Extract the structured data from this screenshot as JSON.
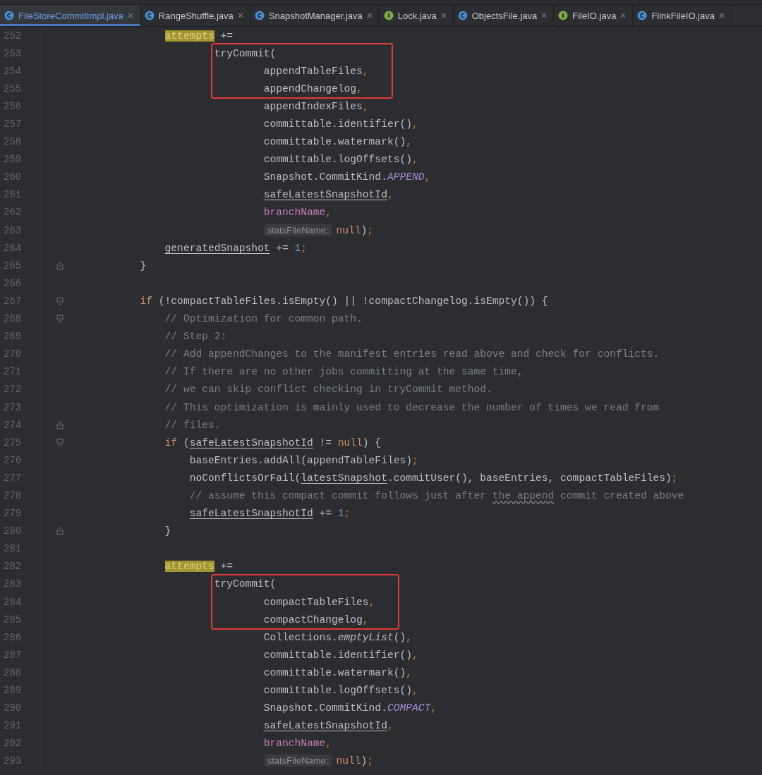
{
  "tabs": [
    {
      "label": "FileStoreCommitImpl.java",
      "kind": "class",
      "selected": true
    },
    {
      "label": "RangeShuffle.java",
      "kind": "class",
      "selected": false
    },
    {
      "label": "SnapshotManager.java",
      "kind": "class",
      "selected": false
    },
    {
      "label": "Lock.java",
      "kind": "interface",
      "selected": false
    },
    {
      "label": "ObjectsFile.java",
      "kind": "abstract",
      "selected": false
    },
    {
      "label": "FileIO.java",
      "kind": "interface",
      "selected": false
    },
    {
      "label": "FlinkFileIO.java",
      "kind": "class",
      "selected": false
    }
  ],
  "code": {
    "lines": [
      {
        "children": [
          {
            "number": "252",
            "continues": true,
            "tokens": [
              {
                "kind": "match",
                "text": "attempts"
              },
              {
                "text": " +="
              }
            ],
            "children": [
              {
                "number": "253",
                "boxed": true,
                "continues": true,
                "tokens": [
                  {
                    "text": "tryCommit("
                  }
                ],
                "children": [
                  {
                    "number": "254",
                    "boxed": true,
                    "tokens": [
                      {
                        "text": "appendTableFiles"
                      },
                      {
                        "kind": "punct",
                        "text": ","
                      }
                    ]
                  },
                  {
                    "number": "255",
                    "boxed": true,
                    "tokens": [
                      {
                        "text": "appendChangelog"
                      },
                      {
                        "kind": "punct",
                        "text": ","
                      }
                    ]
                  },
                  {
                    "number": "256",
                    "tokens": [
                      {
                        "text": "appendIndexFiles"
                      },
                      {
                        "kind": "punct",
                        "text": ","
                      }
                    ]
                  },
                  {
                    "number": "257",
                    "tokens": [
                      {
                        "text": "committable.identifier()"
                      },
                      {
                        "kind": "punct",
                        "text": ","
                      }
                    ]
                  },
                  {
                    "number": "258",
                    "tokens": [
                      {
                        "text": "committable.watermark()"
                      },
                      {
                        "kind": "punct",
                        "text": ","
                      }
                    ]
                  },
                  {
                    "number": "259",
                    "tokens": [
                      {
                        "text": "committable.logOffsets()"
                      },
                      {
                        "kind": "punct",
                        "text": ","
                      }
                    ]
                  },
                  {
                    "number": "260",
                    "tokens": [
                      {
                        "text": "Snapshot.CommitKind."
                      },
                      {
                        "kind": "const",
                        "text": "APPEND"
                      },
                      {
                        "kind": "punct",
                        "text": ","
                      }
                    ]
                  },
                  {
                    "number": "261",
                    "tokens": [
                      {
                        "kind": "ul",
                        "text": "safeLatestSnapshotId"
                      },
                      {
                        "kind": "punct",
                        "text": ","
                      }
                    ]
                  },
                  {
                    "number": "262",
                    "tokens": [
                      {
                        "kind": "field",
                        "text": "branchName"
                      },
                      {
                        "kind": "punct",
                        "text": ","
                      }
                    ]
                  },
                  {
                    "number": "263",
                    "tokens": [
                      {
                        "kind": "hint",
                        "text": "statsFileName:"
                      },
                      {
                        "kind": "kw",
                        "text": "null"
                      },
                      {
                        "text": ")"
                      },
                      {
                        "kind": "punct",
                        "text": ";"
                      }
                    ]
                  }
                ]
              }
            ]
          },
          {
            "number": "264",
            "tokens": [
              {
                "kind": "ul",
                "text": "generatedSnapshot"
              },
              {
                "text": " += "
              },
              {
                "kind": "num",
                "text": "1"
              },
              {
                "kind": "punct",
                "text": ";"
              }
            ]
          }
        ]
      },
      {
        "number": "265",
        "fold_end": true,
        "tokens": [
          {
            "text": "}"
          }
        ]
      },
      {
        "number": "266"
      },
      {
        "number": "267",
        "fold_start": true,
        "tokens": [
          {
            "kind": "kw",
            "text": "if"
          },
          {
            "text": " (!compactTableFiles.isEmpty() || !compactChangelog.isEmpty()) {"
          }
        ],
        "children": [
          {
            "number": "268",
            "fold_start": true,
            "tokens": [
              {
                "kind": "comment",
                "text": "// Optimization for common path."
              }
            ]
          },
          {
            "number": "269",
            "tokens": [
              {
                "kind": "comment",
                "text": "// Step 2:"
              }
            ]
          },
          {
            "number": "270",
            "tokens": [
              {
                "kind": "comment",
                "text": "// Add appendChanges to the manifest entries read above and check for conflicts."
              }
            ]
          },
          {
            "number": "271",
            "tokens": [
              {
                "kind": "comment",
                "text": "// If there are no other jobs committing at the same time,"
              }
            ]
          },
          {
            "number": "272",
            "tokens": [
              {
                "kind": "comment",
                "text": "// we can skip conflict checking in tryCommit method."
              }
            ]
          },
          {
            "number": "273",
            "tokens": [
              {
                "kind": "comment",
                "text": "// This optimization is mainly used to decrease the number of times we read from"
              }
            ]
          },
          {
            "number": "274",
            "fold_end": true,
            "tokens": [
              {
                "kind": "comment",
                "text": "// files."
              }
            ]
          },
          {
            "number": "275",
            "fold_start": true,
            "tokens": [
              {
                "kind": "kw",
                "text": "if"
              },
              {
                "text": " ("
              },
              {
                "kind": "ul",
                "text": "safeLatestSnapshotId"
              },
              {
                "text": " != "
              },
              {
                "kind": "kw",
                "text": "null"
              },
              {
                "text": ") {"
              }
            ],
            "children": [
              {
                "number": "276",
                "tokens": [
                  {
                    "text": "baseEntries.addAll(appendTableFiles)"
                  },
                  {
                    "kind": "punct",
                    "text": ";"
                  }
                ]
              },
              {
                "number": "277",
                "tokens": [
                  {
                    "text": "noConflictsOrFail("
                  },
                  {
                    "kind": "ul",
                    "text": "latestSnapshot"
                  },
                  {
                    "text": ".commitUser(), baseEntries, compactTableFiles)"
                  },
                  {
                    "kind": "punct",
                    "text": ";"
                  }
                ]
              },
              {
                "number": "278",
                "tokens": [
                  {
                    "kind": "comment",
                    "text": "// assume this compact commit follows just after "
                  },
                  {
                    "kind": "typo",
                    "text": "the append"
                  },
                  {
                    "kind": "comment",
                    "text": " commit created above"
                  }
                ]
              },
              {
                "number": "279",
                "tokens": [
                  {
                    "kind": "ul",
                    "text": "safeLatestSnapshotId"
                  },
                  {
                    "text": " += "
                  },
                  {
                    "kind": "num",
                    "text": "1"
                  },
                  {
                    "kind": "punct",
                    "text": ";"
                  }
                ]
              }
            ]
          },
          {
            "number": "280",
            "fold_end": true,
            "tokens": [
              {
                "text": "}"
              }
            ]
          },
          {
            "number": "281"
          },
          {
            "number": "282",
            "continues": true,
            "tokens": [
              {
                "kind": "match",
                "text": "attempts"
              },
              {
                "text": " +="
              }
            ],
            "children": [
              {
                "number": "283",
                "boxed": true,
                "continues": true,
                "tokens": [
                  {
                    "text": "tryCommit("
                  }
                ],
                "children": [
                  {
                    "number": "284",
                    "boxed": true,
                    "tokens": [
                      {
                        "text": "compactTableFiles"
                      },
                      {
                        "kind": "punct",
                        "text": ","
                      }
                    ]
                  },
                  {
                    "number": "285",
                    "boxed": true,
                    "tokens": [
                      {
                        "text": "compactChangelog"
                      },
                      {
                        "kind": "punct",
                        "text": ","
                      }
                    ]
                  },
                  {
                    "number": "286",
                    "tokens": [
                      {
                        "text": "Collections."
                      },
                      {
                        "kind": "italic",
                        "text": "emptyList"
                      },
                      {
                        "text": "()"
                      },
                      {
                        "kind": "punct",
                        "text": ","
                      }
                    ]
                  },
                  {
                    "number": "287",
                    "tokens": [
                      {
                        "text": "committable.identifier()"
                      },
                      {
                        "kind": "punct",
                        "text": ","
                      }
                    ]
                  },
                  {
                    "number": "288",
                    "tokens": [
                      {
                        "text": "committable.watermark()"
                      },
                      {
                        "kind": "punct",
                        "text": ","
                      }
                    ]
                  },
                  {
                    "number": "289",
                    "tokens": [
                      {
                        "text": "committable.logOffsets()"
                      },
                      {
                        "kind": "punct",
                        "text": ","
                      }
                    ]
                  },
                  {
                    "number": "290",
                    "tokens": [
                      {
                        "text": "Snapshot.CommitKind."
                      },
                      {
                        "kind": "const",
                        "text": "COMPACT"
                      },
                      {
                        "kind": "punct",
                        "text": ","
                      }
                    ]
                  },
                  {
                    "number": "291",
                    "tokens": [
                      {
                        "kind": "ul",
                        "text": "safeLatestSnapshotId"
                      },
                      {
                        "kind": "punct",
                        "text": ","
                      }
                    ]
                  },
                  {
                    "number": "292",
                    "tokens": [
                      {
                        "kind": "field",
                        "text": "branchName"
                      },
                      {
                        "kind": "punct",
                        "text": ","
                      }
                    ]
                  },
                  {
                    "number": "293",
                    "tokens": [
                      {
                        "kind": "hint",
                        "text": "statsFileName:"
                      },
                      {
                        "kind": "kw",
                        "text": "null"
                      },
                      {
                        "text": ")"
                      },
                      {
                        "kind": "punct",
                        "text": ";"
                      }
                    ]
                  }
                ]
              }
            ]
          }
        ]
      }
    ]
  }
}
